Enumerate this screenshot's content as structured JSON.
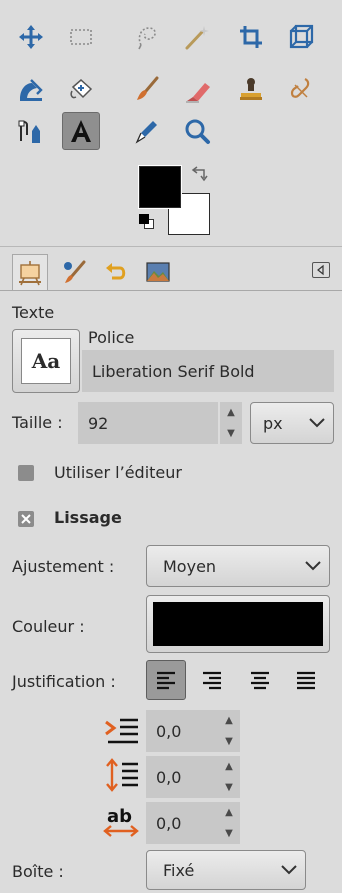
{
  "toolbox": {
    "tools": [
      {
        "name": "move-tool-icon"
      },
      {
        "name": "rect-select-tool-icon"
      },
      {
        "name": "free-select-tool-icon"
      },
      {
        "name": "fuzzy-select-tool-icon"
      },
      {
        "name": "crop-tool-icon"
      },
      {
        "name": "perspective-tool-icon"
      },
      {
        "name": "bucket-fill-tool-icon"
      },
      {
        "name": "heal-tool-icon"
      },
      {
        "name": "paintbrush-tool-icon"
      },
      {
        "name": "eraser-tool-icon"
      },
      {
        "name": "clone-stamp-tool-icon"
      },
      {
        "name": "smudge-tool-icon"
      },
      {
        "name": "paths-tool-icon"
      },
      {
        "name": "text-tool-icon",
        "active": true
      },
      {
        "name": "color-picker-tool-icon"
      },
      {
        "name": "zoom-tool-icon"
      }
    ],
    "foreground_color": "#000000",
    "background_color": "#ffffff"
  },
  "dock_tabs": [
    "tool-options-tab",
    "brushes-tab",
    "undo-history-tab",
    "images-tab"
  ],
  "options": {
    "section_title": "Texte",
    "font_label": "Police",
    "font_preview": "Aa",
    "font_value": "Liberation Serif Bold",
    "size_label": "Taille :",
    "size_value": "92",
    "unit_value": "px",
    "use_editor_label": "Utiliser l’éditeur",
    "use_editor_checked": false,
    "antialias_label": "Lissage",
    "antialias_checked": true,
    "hinting_label": "Ajustement :",
    "hinting_value": "Moyen",
    "color_label": "Couleur :",
    "color_value": "#000000",
    "justify_label": "Justification :",
    "justify_selected": "left",
    "indent_value": "0,0",
    "line_spacing_value": "0,0",
    "letter_spacing_value": "0,0",
    "box_label": "Boîte :",
    "box_value": "Fixé"
  }
}
